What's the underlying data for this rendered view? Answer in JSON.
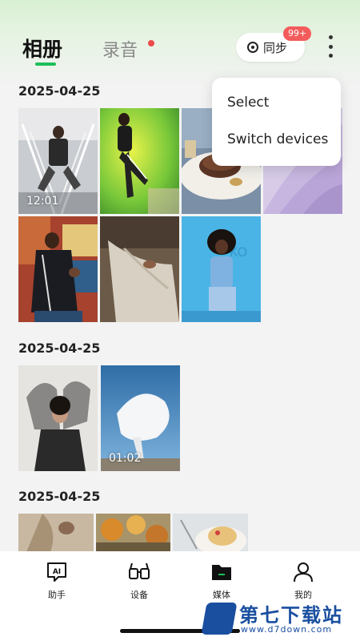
{
  "header": {
    "tab_album": "相册",
    "tab_recording": "录音",
    "sync_label": "同步",
    "sync_badge": "99+"
  },
  "sections": [
    {
      "date": "2025-04-25",
      "items": [
        {
          "type": "video",
          "duration": "12:01",
          "subject": "person in checkered outfit with neon light frame"
        },
        {
          "type": "photo",
          "subject": "person in tracksuit on green background"
        },
        {
          "type": "photo",
          "subject": "grilled steak on plate"
        },
        {
          "type": "photo",
          "subject": "lavender fabric folds"
        },
        {
          "type": "photo",
          "subject": "person in varsity jacket"
        },
        {
          "type": "photo",
          "subject": "person lying on couch"
        },
        {
          "type": "photo",
          "subject": "person on blue wall background"
        }
      ]
    },
    {
      "date": "2025-04-25",
      "items": [
        {
          "type": "photo",
          "subject": "person with sheer black sleeves"
        },
        {
          "type": "video",
          "duration": "01:02",
          "subject": "white fabric against sky"
        }
      ]
    },
    {
      "date": "2025-04-25",
      "items": [
        {
          "type": "photo",
          "subject": "beige coat closeup"
        },
        {
          "type": "photo",
          "subject": "autumn leaves"
        },
        {
          "type": "photo",
          "subject": "cake with fruit"
        }
      ]
    }
  ],
  "dropdown_menu": {
    "items": [
      "Select",
      "Switch devices"
    ]
  },
  "bottom_nav": {
    "items": [
      {
        "label": "助手",
        "icon": "ai-assistant-icon",
        "icon_text": "AI"
      },
      {
        "label": "设备",
        "icon": "glasses-icon"
      },
      {
        "label": "媒体",
        "icon": "folder-icon"
      },
      {
        "label": "我的",
        "icon": "person-icon"
      }
    ]
  },
  "watermark": {
    "title": "第七下载站",
    "url": "www.d7down.com"
  },
  "colors": {
    "accent_green": "#1dbf5a",
    "badge_red": "#f45c5c",
    "watermark_blue": "#1a4fa0"
  }
}
